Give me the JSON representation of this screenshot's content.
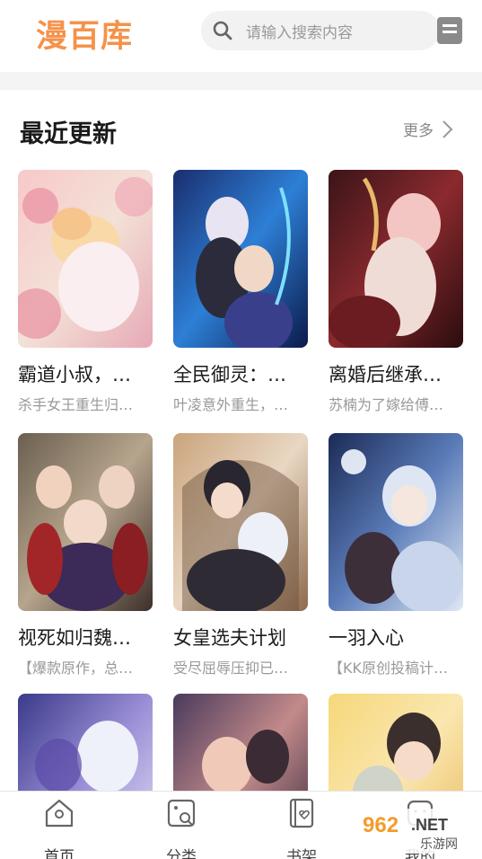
{
  "app": {
    "logo": "漫百库",
    "search_placeholder": "请输入搜索内容"
  },
  "section": {
    "title": "最近更新",
    "more_label": "更多"
  },
  "comics": [
    {
      "title": "霸道小叔，…",
      "desc": "杀手女王重生归…"
    },
    {
      "title": "全民御灵：…",
      "desc": "叶凌意外重生，…"
    },
    {
      "title": "离婚后继承…",
      "desc": "苏楠为了嫁给傅…"
    },
    {
      "title": "视死如归魏…",
      "desc": "【爆款原作，总…"
    },
    {
      "title": "女皇选夫计划",
      "desc": "受尽屈辱压抑已…"
    },
    {
      "title": "一羽入心",
      "desc": "【KK原创投稿计…"
    },
    {
      "title": "",
      "desc": ""
    },
    {
      "title": "",
      "desc": ""
    },
    {
      "title": "",
      "desc": ""
    }
  ],
  "tabs": [
    {
      "label": "首页",
      "icon": "home-icon"
    },
    {
      "label": "分类",
      "icon": "category-icon"
    },
    {
      "label": "书架",
      "icon": "bookshelf-icon"
    },
    {
      "label": "我的",
      "icon": "profile-icon"
    }
  ],
  "watermark": {
    "brand": "962.NET",
    "sub": "乐游网"
  },
  "colors": {
    "accent": "#f5924a",
    "search_bg": "#f2f2f2",
    "muted": "#999999"
  }
}
